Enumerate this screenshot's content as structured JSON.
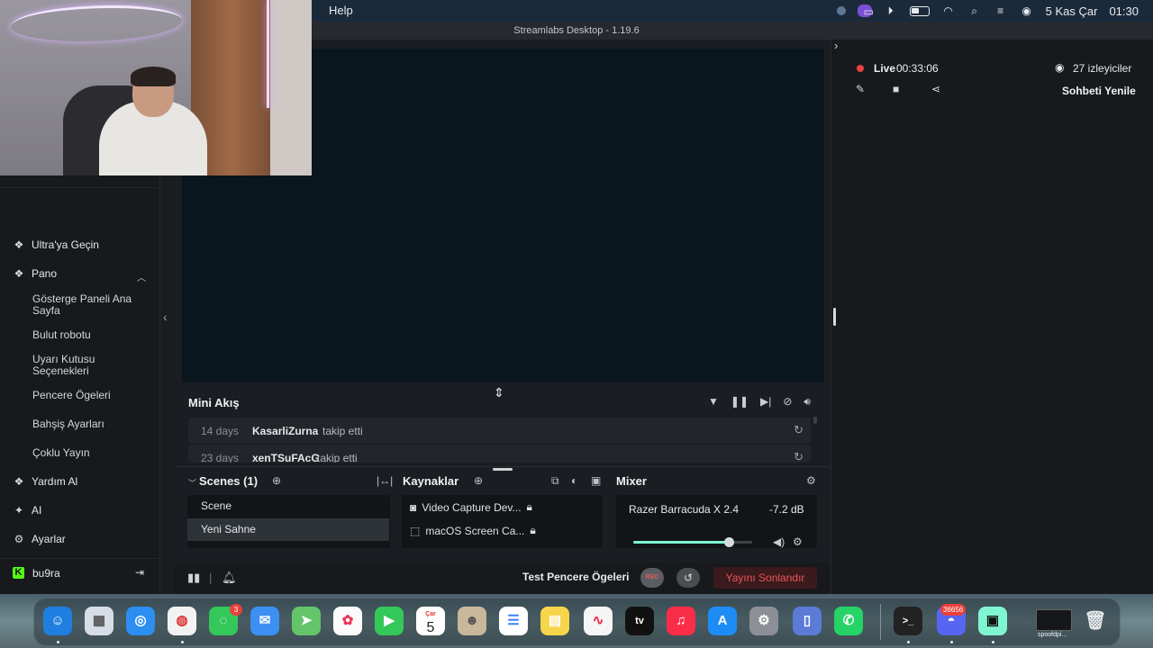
{
  "menubar": {
    "help": "Help",
    "date": "5 Kas Çar",
    "time": "01:30"
  },
  "window": {
    "title": "Streamlabs Desktop - 1.19.6"
  },
  "sidebar": {
    "items": [
      {
        "label": "Ultra'ya Geçin",
        "icon": "ultra-icon"
      },
      {
        "label": "Pano",
        "icon": "dashboard-icon"
      },
      {
        "label": "Yardım Al",
        "icon": "help-icon"
      },
      {
        "label": "AI",
        "icon": "ai-sparkle-icon"
      },
      {
        "label": "Ayarlar",
        "icon": "gear-icon"
      }
    ],
    "subitems": [
      "Gösterge Paneli Ana Sayfa",
      "Bulut robotu",
      "Uyarı Kutusu Seçenekleri",
      "Pencere Ögeleri",
      "Bahşiş Ayarları",
      "Çoklu Yayın"
    ],
    "user": "bu9ra"
  },
  "miniflow": {
    "title": "Mini Akış",
    "rows": [
      {
        "days": "14 days",
        "who": "KasarliZurna",
        "action": "takip etti"
      },
      {
        "days": "23 days",
        "who": "xenTSuFAcG",
        "action": "takip etti"
      }
    ]
  },
  "scenes": {
    "title": "Scenes (1)",
    "items": [
      "Scene",
      "Yeni Sahne"
    ]
  },
  "sources": {
    "title": "Kaynaklar",
    "items": [
      "Video Capture Dev...",
      "macOS Screen Ca..."
    ]
  },
  "mixer": {
    "title": "Mixer",
    "device": "Razer Barracuda X 2.4",
    "db": "-7.2 dB",
    "level": 0.8
  },
  "footer": {
    "test_label": "Test Pencere Ögeleri",
    "rec": "REC",
    "end_stream": "Yayını Sonlandır"
  },
  "chat": {
    "live_label": "Live",
    "live_time": "00:33:06",
    "viewers": "27 izleyiciler",
    "refresh": "Sohbeti Yenile"
  },
  "dock": {
    "messages_badge": "3",
    "calendar_month": "Çar",
    "calendar_day": "5",
    "discord_badge": "36656",
    "spoof_label": "spoofdpi..."
  },
  "colors": {
    "accent": "#80f5d2",
    "live": "#e9433f",
    "end_stream": "#e9555a",
    "kick": "#53fc18"
  }
}
